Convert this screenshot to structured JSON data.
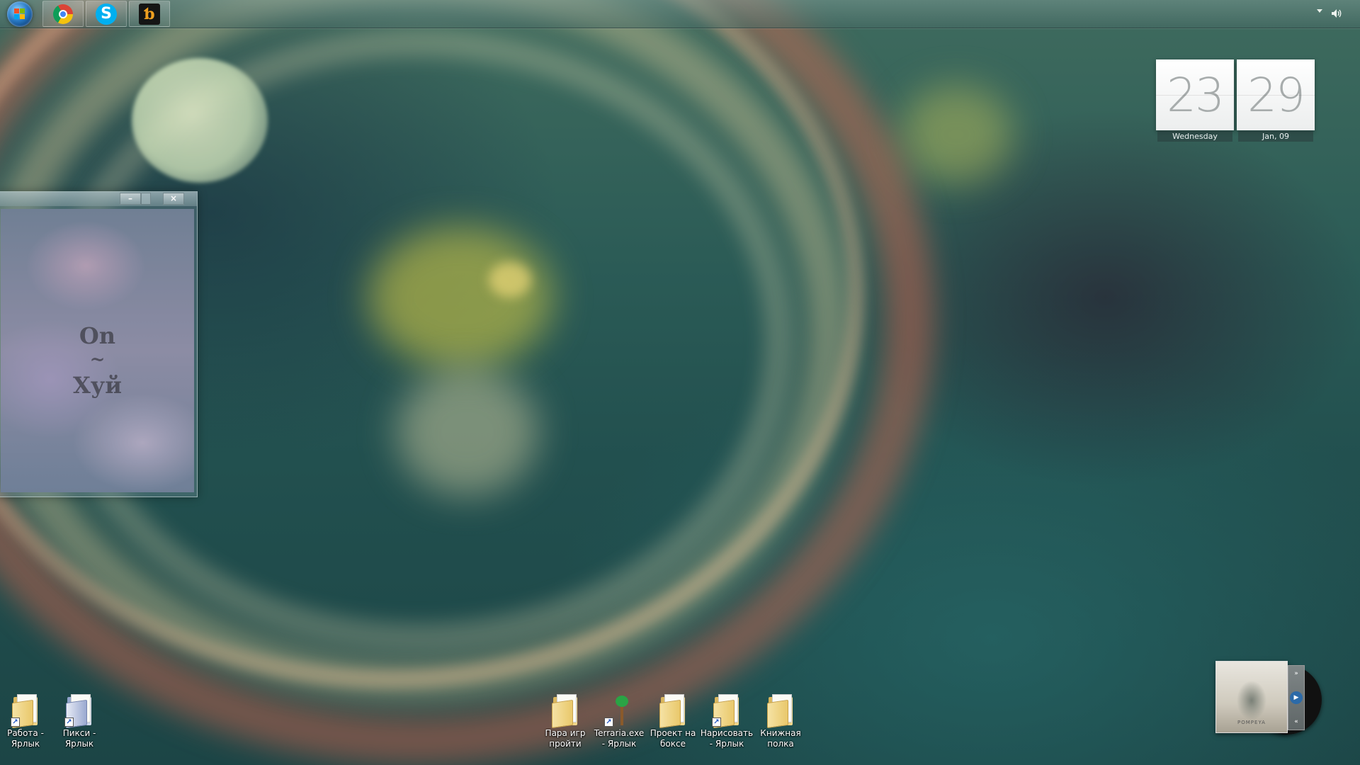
{
  "taskbar": {
    "start_button": "windows-start-orb",
    "pinned": [
      {
        "name": "chrome",
        "icon": "chrome-icon"
      },
      {
        "name": "skype",
        "icon": "skype-icon",
        "glyph": "S"
      },
      {
        "name": "foobar",
        "icon": "foobar-icon",
        "glyph": "ƅ"
      }
    ],
    "tray": {
      "overflow_icon": "chevron-down-icon",
      "volume_icon": "speaker-icon"
    }
  },
  "clock": {
    "hours": "23",
    "minutes": "29",
    "day_label": "Wednesday",
    "date_label": "Jan, 09"
  },
  "floating_window": {
    "minimize_label": "–",
    "close_label": "×",
    "text_line1": "On",
    "text_line2": "~",
    "text_line3": "Хуй"
  },
  "desktop_icons": [
    {
      "label": "Работа - Ярлык",
      "type": "folder-shortcut"
    },
    {
      "label": "Пикси - Ярлык",
      "type": "folder-shortcut"
    },
    {
      "label": "Пара игр пройти",
      "type": "folder"
    },
    {
      "label": "Terraria.exe - Ярлык",
      "type": "app-shortcut"
    },
    {
      "label": "Проект на боксе",
      "type": "folder"
    },
    {
      "label": "Нарисовать - Ярлык",
      "type": "folder-shortcut"
    },
    {
      "label": "Книжная полка",
      "type": "folder"
    }
  ],
  "player": {
    "album_title": "POMPEYA",
    "next_icon": "fast-forward-icon",
    "play_icon": "play-icon",
    "prev_icon": "rewind-icon"
  }
}
